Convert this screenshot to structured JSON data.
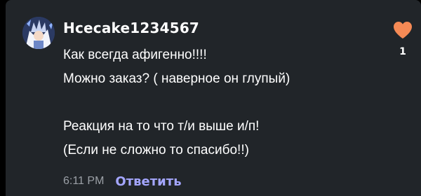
{
  "comment": {
    "username": "Hcecake1234567",
    "lines": [
      "Как всегда афигенно!!!!",
      "Можно заказ? ( наверное он глупый)",
      "",
      "Реакция на то что т/и выше и/п!",
      "(Если не сложно то спасибо!!)"
    ],
    "timestamp": "6:11 PM",
    "reply_label": "Ответить",
    "like_count": "1"
  },
  "icons": {
    "avatar": "anime-character-avatar",
    "like": "heart-icon"
  },
  "colors": {
    "panel_background": "#212529",
    "heart": "#f58a55",
    "reply_link": "#a4a6ff",
    "timestamp": "#9ba0a6",
    "text": "#ffffff"
  }
}
